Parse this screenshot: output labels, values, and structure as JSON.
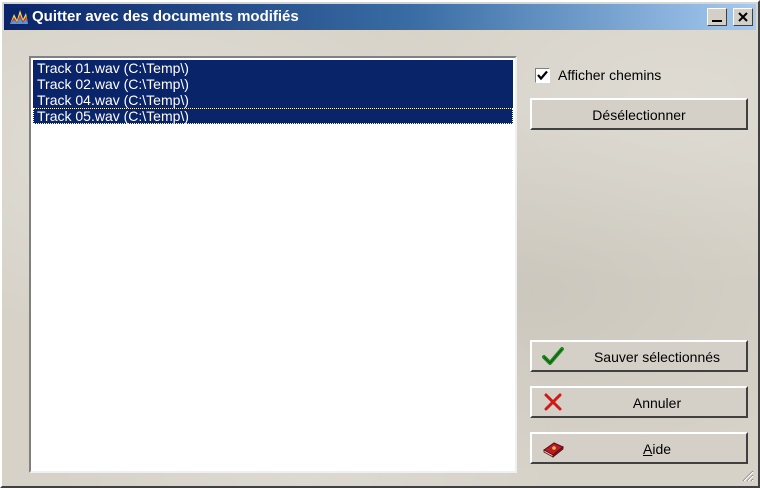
{
  "window": {
    "title": "Quitter avec des documents modifiés"
  },
  "documents": [
    {
      "label": "Track 01.wav (C:\\Temp\\)"
    },
    {
      "label": "Track 02.wav (C:\\Temp\\)"
    },
    {
      "label": "Track 04.wav (C:\\Temp\\)"
    },
    {
      "label": "Track 05.wav (C:\\Temp\\)"
    }
  ],
  "options": {
    "show_paths_label": "Afficher chemins",
    "show_paths_checked": true
  },
  "buttons": {
    "deselect": "Désélectionner",
    "save_selected": "Sauver sélectionnés",
    "cancel": "Annuler",
    "help": "Aide"
  },
  "icons": {
    "app": "waveform-app-icon",
    "save": "green-check-icon",
    "cancel": "red-x-icon",
    "help": "help-book-icon"
  },
  "colors": {
    "titlebar_start": "#0a246a",
    "titlebar_end": "#a6caf0",
    "selection": "#0a246a",
    "check_green": "#1e8c1e",
    "cancel_red": "#d01818"
  }
}
